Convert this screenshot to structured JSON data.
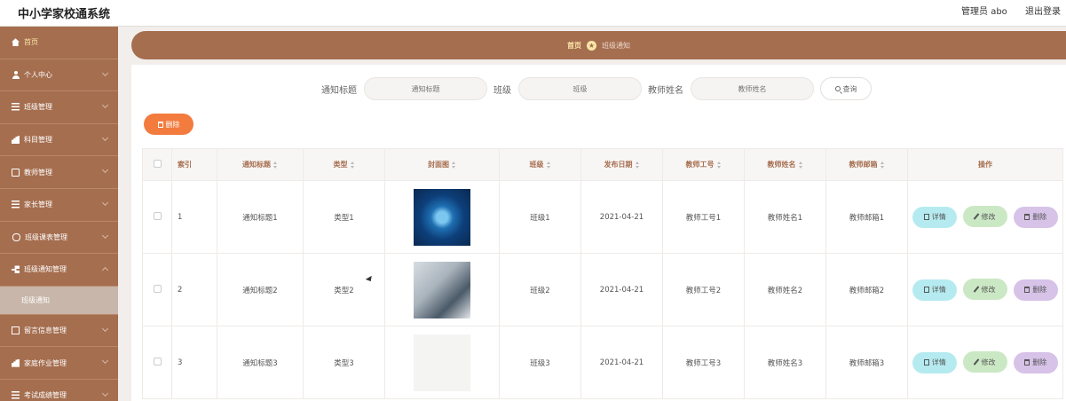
{
  "app": {
    "title": "中小学家校通系统"
  },
  "topbar": {
    "user_label": "管理员 abo",
    "logout_label": "退出登录"
  },
  "sidebar": {
    "items": [
      {
        "label": "首页",
        "icon": "home-icon"
      },
      {
        "label": "个人中心",
        "icon": "user-icon"
      },
      {
        "label": "班级管理",
        "icon": "list-icon"
      },
      {
        "label": "科目管理",
        "icon": "bar-chart-icon"
      },
      {
        "label": "教师管理",
        "icon": "monitor-icon"
      },
      {
        "label": "家长管理",
        "icon": "list-icon"
      },
      {
        "label": "班级课表管理",
        "icon": "mic-icon"
      },
      {
        "label": "班级通知管理",
        "icon": "grid-icon"
      },
      {
        "label": "留言信息管理",
        "icon": "mail-icon"
      },
      {
        "label": "家庭作业管理",
        "icon": "bar-chart-icon"
      },
      {
        "label": "考试成绩管理",
        "icon": "list-icon"
      }
    ],
    "active_sub": "班级通知"
  },
  "breadcrumb": {
    "home": "首页",
    "current": "班级通知"
  },
  "search": {
    "title_label": "通知标题",
    "title_placeholder": "通知标题",
    "class_label": "班级",
    "class_placeholder": "班级",
    "teacher_label": "教师姓名",
    "teacher_placeholder": "教师姓名",
    "button": "查询"
  },
  "toolbar": {
    "delete_label": "删除"
  },
  "table": {
    "headers": [
      "索引",
      "通知标题",
      "类型",
      "封面图",
      "班级",
      "发布日期",
      "教师工号",
      "教师姓名",
      "教师邮箱",
      "操作"
    ],
    "rows": [
      {
        "index": "1",
        "title": "通知标题1",
        "type": "类型1",
        "class": "班级1",
        "date": "2021-04-21",
        "teacher_no": "教师工号1",
        "teacher_name": "教师姓名1",
        "teacher_email": "教师邮箱1"
      },
      {
        "index": "2",
        "title": "通知标题2",
        "type": "类型2",
        "class": "班级2",
        "date": "2021-04-21",
        "teacher_no": "教师工号2",
        "teacher_name": "教师姓名2",
        "teacher_email": "教师邮箱2"
      },
      {
        "index": "3",
        "title": "通知标题3",
        "type": "类型3",
        "class": "班级3",
        "date": "2021-04-21",
        "teacher_no": "教师工号3",
        "teacher_name": "教师姓名3",
        "teacher_email": "教师邮箱3"
      }
    ],
    "actions": {
      "detail": "详情",
      "edit": "修改",
      "delete": "删除"
    }
  },
  "colors": {
    "brand": "#a56e4f",
    "accent_orange": "#f27b3d",
    "highlight": "#fbe7a7"
  }
}
